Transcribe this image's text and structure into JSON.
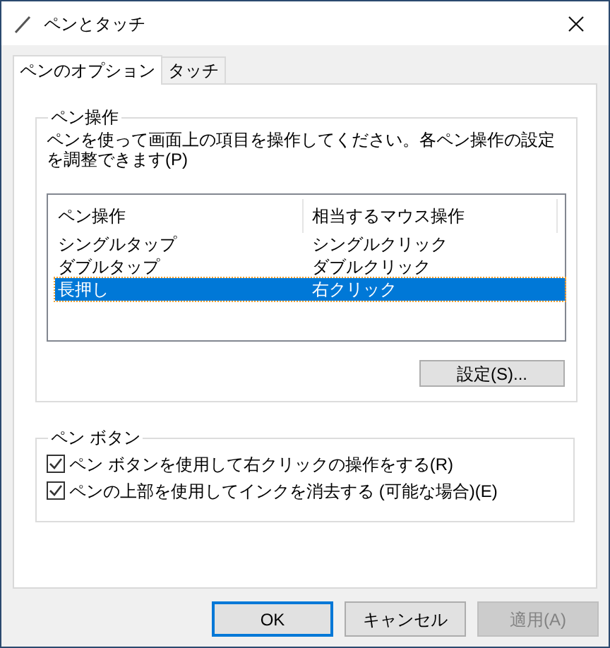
{
  "window": {
    "title": "ペンとタッチ"
  },
  "tabs": [
    {
      "label": "ペンのオプション",
      "selected": true
    },
    {
      "label": "タッチ",
      "selected": false
    }
  ],
  "pen_actions": {
    "title": "ペン操作",
    "description": "ペンを使って画面上の項目を操作してください。各ペン操作の設定を調整できます(P)",
    "columns": [
      "ペン操作",
      "相当するマウス操作"
    ],
    "rows": [
      {
        "cells": [
          "シングルタップ",
          "シングルクリック"
        ],
        "selected": false
      },
      {
        "cells": [
          "ダブルタップ",
          "ダブルクリック"
        ],
        "selected": false
      },
      {
        "cells": [
          "長押し",
          "右クリック"
        ],
        "selected": true
      }
    ],
    "settings_button": "設定(S)..."
  },
  "pen_buttons": {
    "title": "ペン ボタン",
    "options": [
      {
        "label": "ペン ボタンを使用して右クリックの操作をする(R)",
        "checked": true
      },
      {
        "label": "ペンの上部を使用してインクを消去する (可能な場合)(E)",
        "checked": true
      }
    ]
  },
  "buttons": [
    {
      "label": "OK",
      "default": true,
      "disabled": false
    },
    {
      "label": "キャンセル",
      "default": false,
      "disabled": false
    },
    {
      "label": "適用(A)",
      "default": false,
      "disabled": true
    }
  ]
}
